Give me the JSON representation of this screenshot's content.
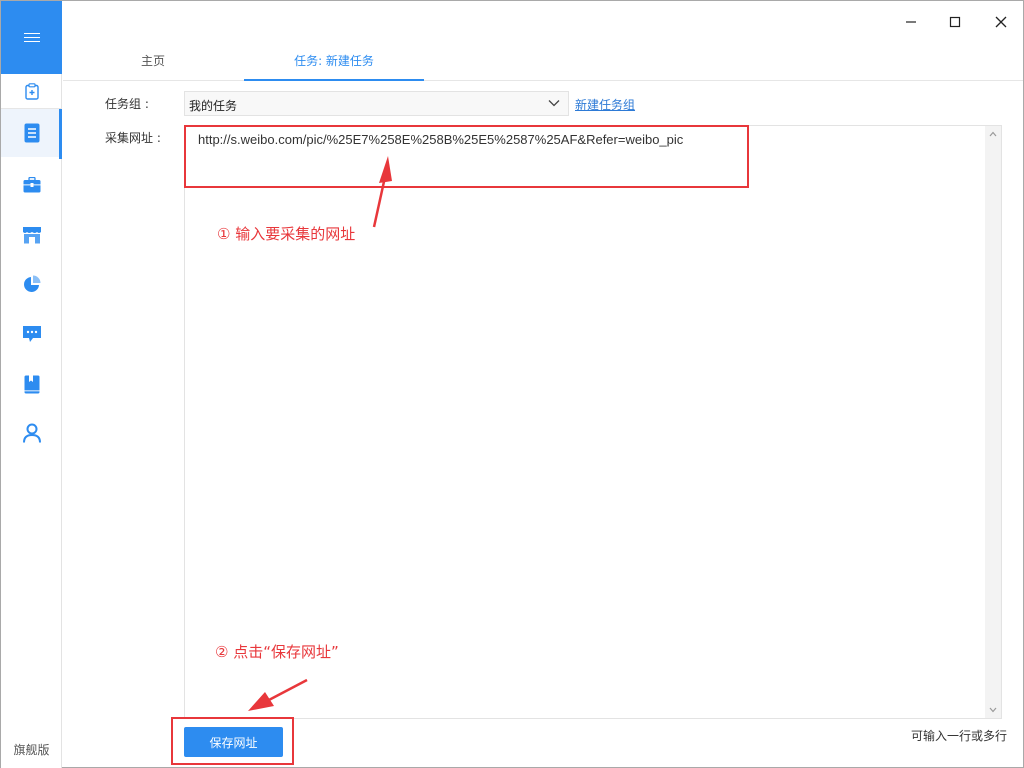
{
  "sidebar": {
    "items": [
      {
        "name": "sidebar-item-clipboard",
        "icon": "clipboard-add-icon"
      },
      {
        "name": "sidebar-item-tasks",
        "icon": "document-list-icon",
        "active": true
      },
      {
        "name": "sidebar-item-toolbox",
        "icon": "briefcase-icon"
      },
      {
        "name": "sidebar-item-store",
        "icon": "store-icon"
      },
      {
        "name": "sidebar-item-stats",
        "icon": "pie-chart-icon"
      },
      {
        "name": "sidebar-item-messages",
        "icon": "chat-icon"
      },
      {
        "name": "sidebar-item-docs",
        "icon": "book-icon"
      },
      {
        "name": "sidebar-item-account",
        "icon": "user-icon"
      }
    ],
    "footer": "旗舰版"
  },
  "tabs": [
    {
      "label": "主页",
      "active": false
    },
    {
      "label": "任务: 新建任务",
      "active": true
    }
  ],
  "form": {
    "group_label": "任务组 :",
    "group_value": "我的任务",
    "new_group_link": "新建任务组",
    "url_label": "采集网址 :",
    "url_value": "http://s.weibo.com/pic/%25E7%258E%258B%25E5%2587%25AF&Refer=weibo_pic",
    "save_label": "保存网址",
    "hint": "可输入一行或多行"
  },
  "annotations": {
    "step1": "① 输入要采集的网址",
    "step2": "② 点击“保存网址”"
  },
  "colors": {
    "accent": "#2d8cf0",
    "annotation": "#e8373b"
  }
}
